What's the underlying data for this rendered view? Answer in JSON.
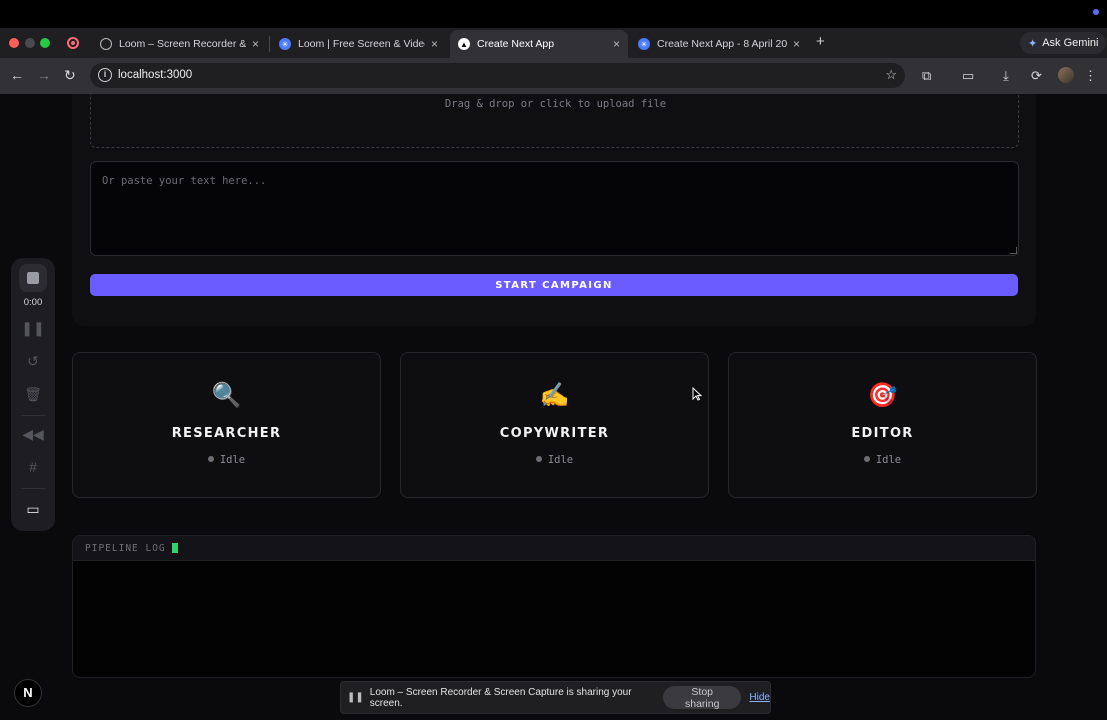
{
  "browser": {
    "tabs": [
      {
        "title": "Loom – Screen Recorder & Sc",
        "favicon": "globe-icon",
        "active": false
      },
      {
        "title": "Loom | Free Screen & Video R",
        "favicon": "loom-icon",
        "active": false
      },
      {
        "title": "Create Next App",
        "favicon": "vercel-triangle-icon",
        "active": true
      },
      {
        "title": "Create Next App - 8 April 20",
        "favicon": "loom-icon",
        "active": false
      }
    ],
    "close_glyph": "×",
    "new_tab_glyph": "+",
    "gemini_label": "Ask Gemini",
    "url": "localhost:3000"
  },
  "upload": {
    "drop_text": "Drag & drop or click to upload file"
  },
  "text_input": {
    "placeholder": "Or paste your text here..."
  },
  "start_button": {
    "label": "START CAMPAIGN"
  },
  "agents": [
    {
      "emoji": "🔍",
      "name": "RESEARCHER",
      "status": "Idle"
    },
    {
      "emoji": "✍️",
      "name": "COPYWRITER",
      "status": "Idle"
    },
    {
      "emoji": "🎯",
      "name": "EDITOR",
      "status": "Idle"
    }
  ],
  "log": {
    "title": "PIPELINE LOG"
  },
  "loom_toolbar": {
    "time": "0:00"
  },
  "next_badge": "N",
  "share_bar": {
    "message": "Loom – Screen Recorder & Screen Capture is sharing your screen.",
    "stop_label": "Stop sharing",
    "hide_label": "Hide"
  },
  "colors": {
    "accent": "#6a5cff",
    "log_caret": "#2bd46e"
  }
}
